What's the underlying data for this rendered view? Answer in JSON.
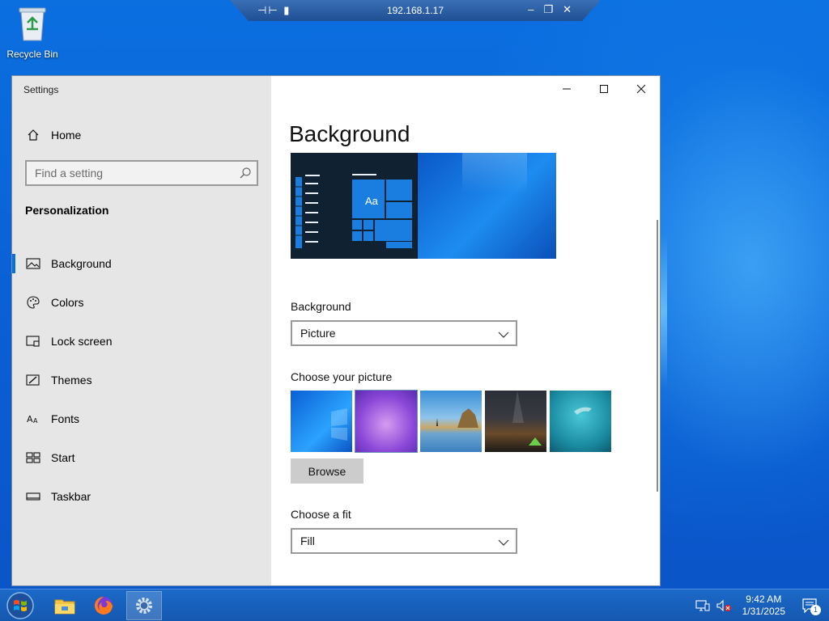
{
  "remote": {
    "title": "192.168.1.17"
  },
  "desktop": {
    "icons": [
      {
        "label": "Recycle Bin",
        "icon": "recycle-bin-icon"
      }
    ]
  },
  "window": {
    "app_title": "Settings",
    "controls": {
      "minimize": "minimize-icon",
      "maximize": "maximize-icon",
      "close": "close-icon"
    }
  },
  "sidebar": {
    "home_label": "Home",
    "search_placeholder": "Find a setting",
    "section_title": "Personalization",
    "items": [
      {
        "label": "Background",
        "icon": "picture-icon",
        "active": true
      },
      {
        "label": "Colors",
        "icon": "palette-icon",
        "active": false
      },
      {
        "label": "Lock screen",
        "icon": "lock-screen-icon",
        "active": false
      },
      {
        "label": "Themes",
        "icon": "themes-icon",
        "active": false
      },
      {
        "label": "Fonts",
        "icon": "fonts-icon",
        "active": false
      },
      {
        "label": "Start",
        "icon": "start-icon",
        "active": false
      },
      {
        "label": "Taskbar",
        "icon": "taskbar-icon",
        "active": false
      }
    ]
  },
  "content": {
    "page_title": "Background",
    "preview_tile_text": "Aa",
    "background_label": "Background",
    "background_value": "Picture",
    "choose_picture_label": "Choose your picture",
    "browse_label": "Browse",
    "choose_fit_label": "Choose a fit",
    "fit_value": "Fill"
  },
  "taskbar": {
    "apps": [
      {
        "name": "file-explorer-icon"
      },
      {
        "name": "firefox-icon"
      },
      {
        "name": "settings-icon",
        "active": true
      }
    ],
    "time": "9:42 AM",
    "date": "1/31/2025",
    "notification_count": "1"
  },
  "colors": {
    "accent": "#0a6fd8",
    "sidebar_bg": "#e6e6e6",
    "taskbar_bg": "#1558b0"
  }
}
